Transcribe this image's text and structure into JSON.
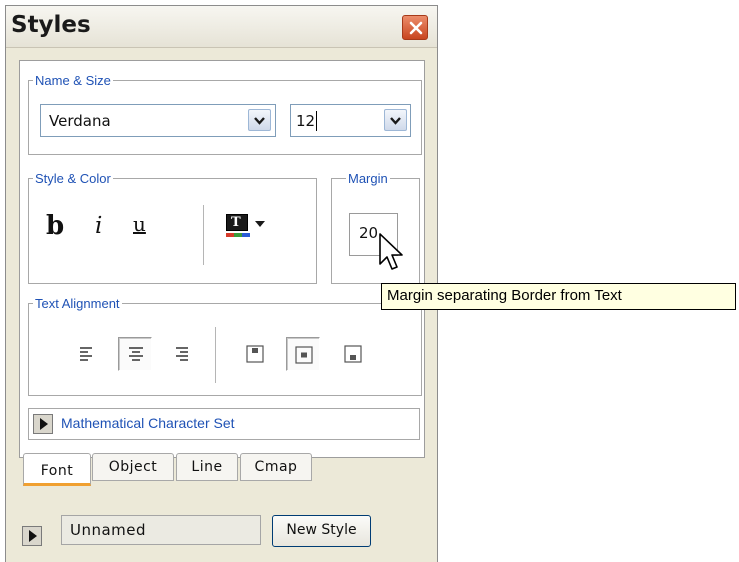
{
  "window": {
    "title": "Styles"
  },
  "name_size": {
    "legend": "Name & Size",
    "font_name": "Verdana",
    "font_size": "12"
  },
  "style_color": {
    "legend": "Style & Color",
    "bold_label": "b",
    "italic_label": "i",
    "underline_label": "u",
    "text_color_glyph": "T"
  },
  "margin": {
    "legend": "Margin",
    "value": "20"
  },
  "tooltip": {
    "text": "Margin separating Border from Text"
  },
  "text_alignment": {
    "legend": "Text Alignment",
    "horizontal": [
      "left",
      "center",
      "right"
    ],
    "selected_horizontal": "center",
    "vertical": [
      "top",
      "middle",
      "bottom"
    ],
    "selected_vertical": "middle"
  },
  "expander": {
    "label": "Mathematical Character Set"
  },
  "tabs": [
    {
      "label": "Font",
      "active": true
    },
    {
      "label": "Object",
      "active": false
    },
    {
      "label": "Line",
      "active": false
    },
    {
      "label": "Cmap",
      "active": false
    }
  ],
  "footer": {
    "style_name": "Unnamed",
    "new_style_label": "New Style"
  },
  "colors": {
    "legend_text": "#1f52b5",
    "window_bg": "#ece9d8",
    "tooltip_bg": "#ffffe1",
    "active_tab_accent": "#f0a030"
  },
  "icons": {
    "close": "close-x-icon",
    "combo_arrow": "chevron-down-icon",
    "expander": "triangle-right-icon",
    "cursor": "mouse-pointer-icon"
  }
}
